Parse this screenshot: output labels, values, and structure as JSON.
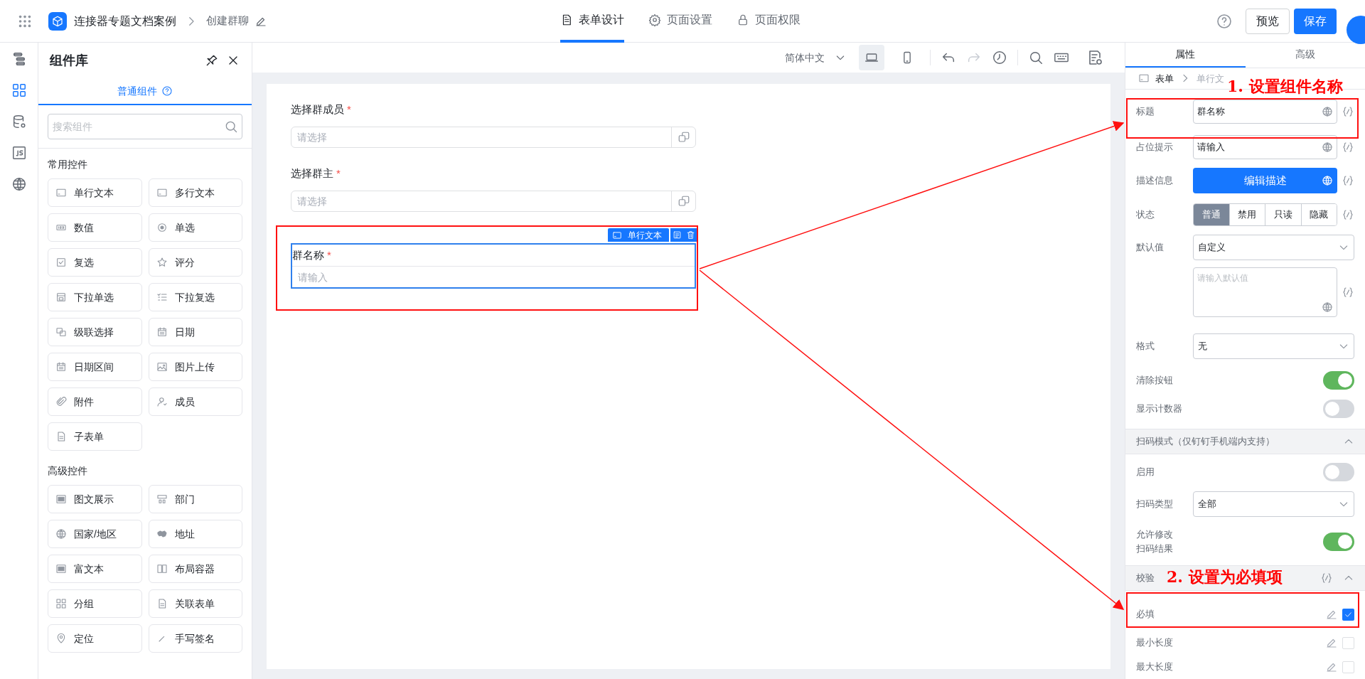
{
  "top_bar": {
    "app_name": "连接器专题文档案例",
    "page_name": "创建群聊",
    "tabs": [
      {
        "label": "表单设计",
        "kind": "form",
        "selected": true
      },
      {
        "label": "页面设置",
        "kind": "settings",
        "selected": false
      },
      {
        "label": "页面权限",
        "kind": "lock",
        "selected": false
      }
    ],
    "preview_button": "预览",
    "save_button": "保存"
  },
  "left_rail": [
    {
      "kind": "outline",
      "selected": false
    },
    {
      "kind": "components",
      "selected": true
    },
    {
      "kind": "data",
      "selected": false
    },
    {
      "kind": "js",
      "selected": false
    },
    {
      "kind": "globe",
      "selected": false
    }
  ],
  "component_panel": {
    "title": "组件库",
    "tab": "普通组件",
    "search_placeholder": "搜索组件",
    "groups": [
      {
        "title": "常用控件",
        "items": [
          {
            "label": "单行文本",
            "kind": "text"
          },
          {
            "label": "多行文本",
            "kind": "text"
          },
          {
            "label": "数值",
            "kind": "number"
          },
          {
            "label": "单选",
            "kind": "radio"
          },
          {
            "label": "复选",
            "kind": "check"
          },
          {
            "label": "评分",
            "kind": "star"
          },
          {
            "label": "下拉单选",
            "kind": "select"
          },
          {
            "label": "下拉复选",
            "kind": "list"
          },
          {
            "label": "级联选择",
            "kind": "cascade"
          },
          {
            "label": "日期",
            "kind": "calendar"
          },
          {
            "label": "日期区间",
            "kind": "calendar"
          },
          {
            "label": "图片上传",
            "kind": "image"
          },
          {
            "label": "附件",
            "kind": "clip"
          },
          {
            "label": "成员",
            "kind": "person"
          },
          {
            "label": "子表单",
            "kind": "doc"
          }
        ]
      },
      {
        "title": "高级控件",
        "items": [
          {
            "label": "图文展示",
            "kind": "panel"
          },
          {
            "label": "部门",
            "kind": "dept"
          },
          {
            "label": "国家/地区",
            "kind": "globe"
          },
          {
            "label": "地址",
            "kind": "map"
          },
          {
            "label": "富文本",
            "kind": "panel"
          },
          {
            "label": "布局容器",
            "kind": "columns"
          },
          {
            "label": "分组",
            "kind": "grid"
          },
          {
            "label": "关联表单",
            "kind": "doc"
          },
          {
            "label": "定位",
            "kind": "pin"
          },
          {
            "label": "手写签名",
            "kind": "pen"
          }
        ]
      }
    ]
  },
  "canvas_toolbar": {
    "language": "简体中文",
    "devices": [
      {
        "kind": "desktop",
        "selected": true
      },
      {
        "kind": "mobile",
        "selected": false
      }
    ]
  },
  "form_fields": [
    {
      "label": "选择群成员",
      "required_mark": "*",
      "placeholder": "请选择",
      "kind": "picker",
      "selected": false
    },
    {
      "label": "选择群主",
      "required_mark": "*",
      "placeholder": "请选择",
      "kind": "picker",
      "selected": false
    },
    {
      "label": "群名称",
      "required_mark": "*",
      "placeholder": "请输入",
      "kind": "text",
      "selected": true
    }
  ],
  "selected_widget_tag": "单行文本",
  "property_panel": {
    "tabs": [
      {
        "label": "属性",
        "selected": true
      },
      {
        "label": "高级",
        "selected": false
      }
    ],
    "breadcrumb": [
      "表单",
      "单行文"
    ],
    "title_label": "标题",
    "title_value": "群名称",
    "placeholder_label": "占位提示",
    "hint_field": {
      "value": "请输入"
    },
    "description_label": "描述信息",
    "description_button": "编辑描述",
    "state_label": "状态",
    "states": [
      {
        "label": "普通",
        "selected": true
      },
      {
        "label": "禁用",
        "selected": false
      },
      {
        "label": "只读",
        "selected": false
      },
      {
        "label": "隐藏",
        "selected": false
      }
    ],
    "default_label": "默认值",
    "default_value": "自定义",
    "default_placeholder": "请输入默认值",
    "format_label": "格式",
    "format_value": "无",
    "clear_button_label": "清除按钮",
    "clear_button_on": true,
    "counter_label": "显示计数器",
    "counter_on": false,
    "scan_section": "扫码模式（仅钉钉手机端内支持）",
    "scan_enable_label": "启用",
    "scan_enable_on": false,
    "scan_type_label": "扫码类型",
    "scan_type_value": "全部",
    "scan_edit_label": "允许修改扫码结果",
    "scan_edit_on": true,
    "validation_section": "校验",
    "rules": [
      {
        "label": "必填",
        "checked": true
      },
      {
        "label": "最小长度",
        "checked": false
      },
      {
        "label": "最大长度",
        "checked": false
      }
    ]
  },
  "annotations": [
    "1. 设置组件名称",
    "2. 设置为必填项"
  ]
}
